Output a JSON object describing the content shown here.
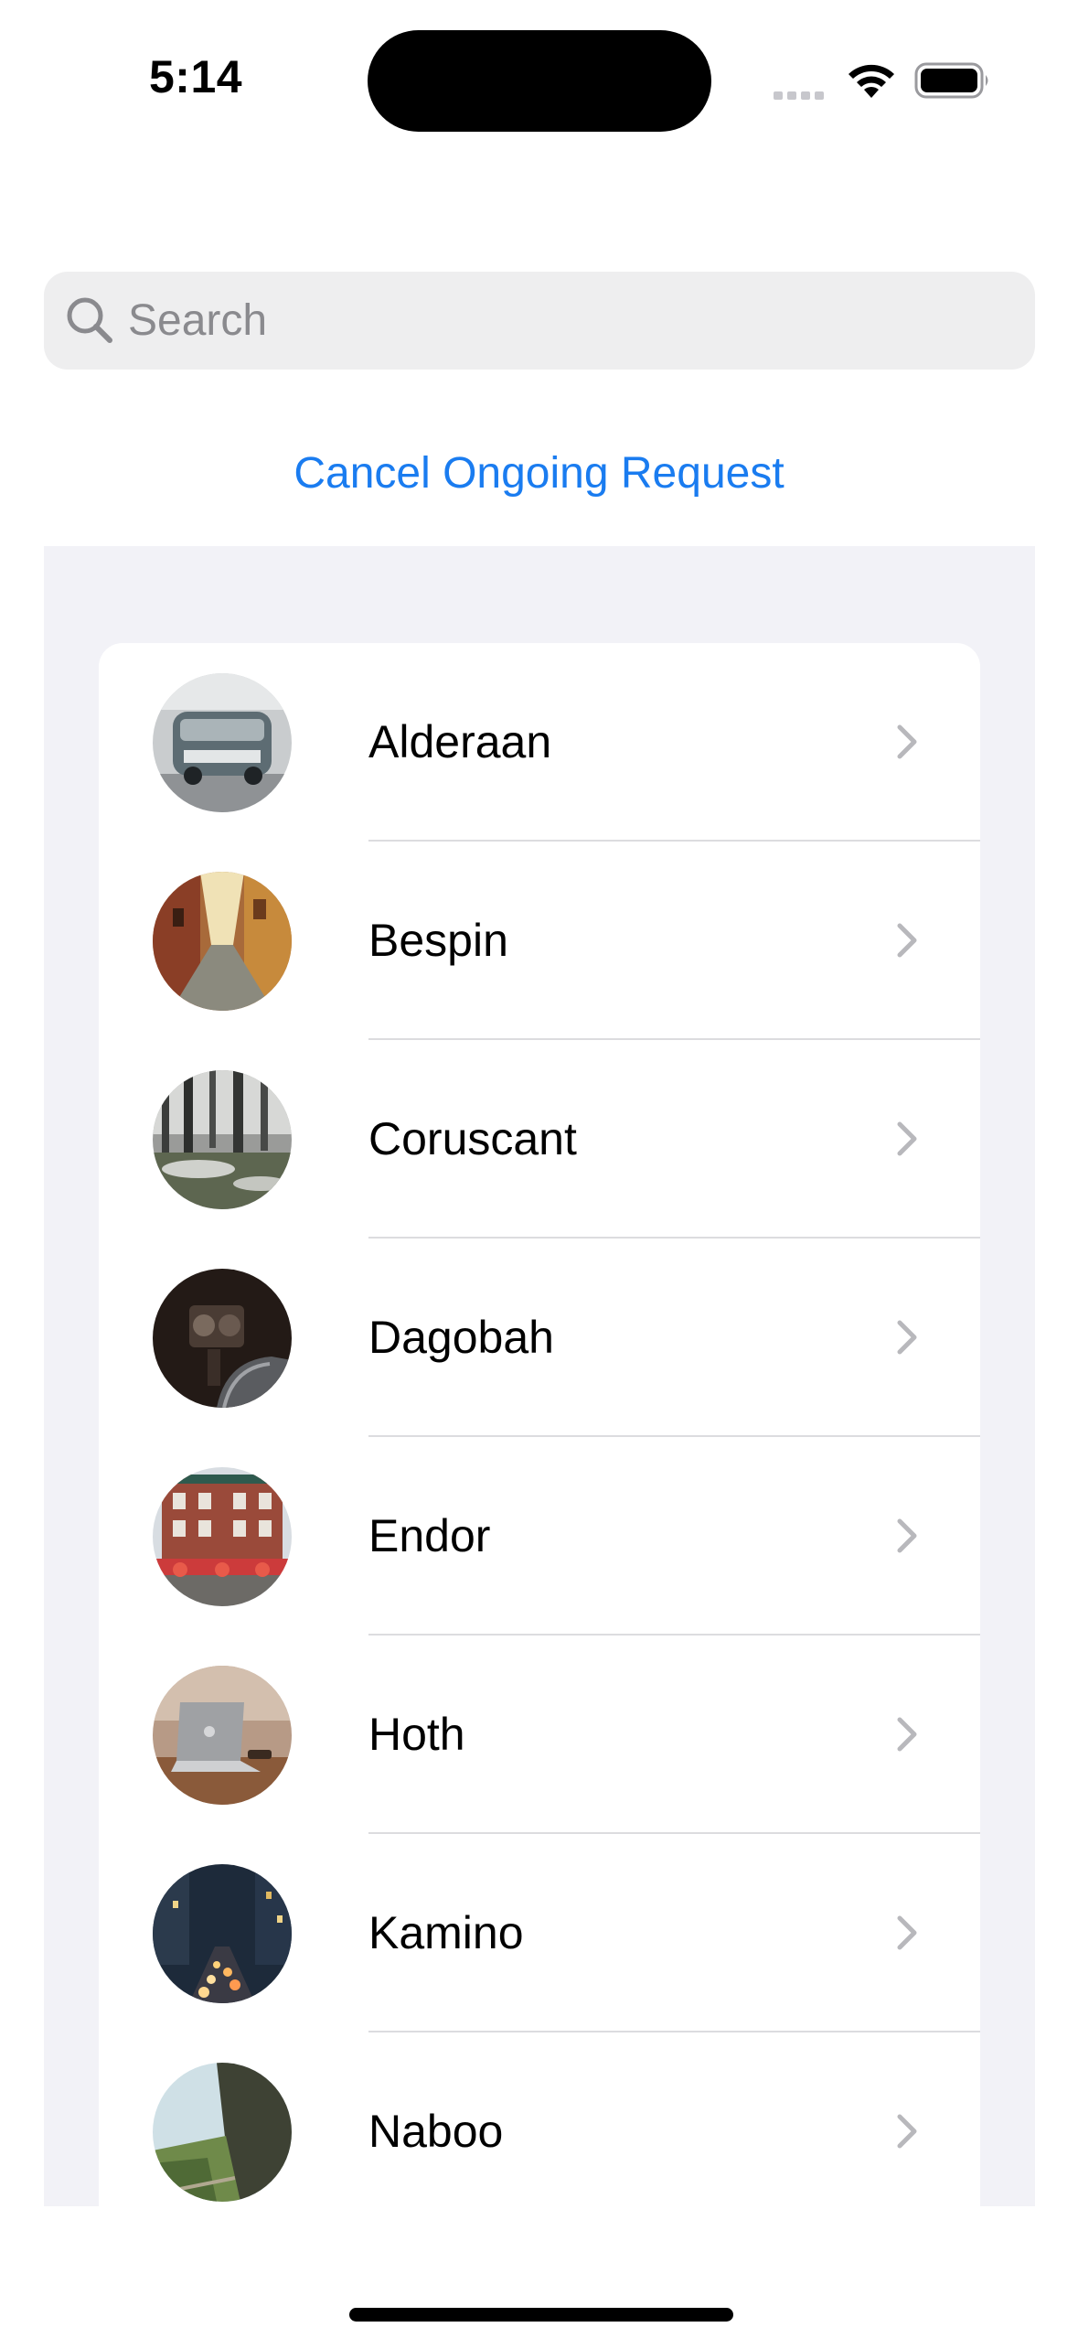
{
  "status_bar": {
    "time": "5:14"
  },
  "search": {
    "placeholder": "Search"
  },
  "cancel_label": "Cancel Ongoing Request",
  "colors": {
    "accent": "#1a7cf0",
    "list_background": "#f2f2f7",
    "chevron": "#b8b8bc"
  },
  "rows": [
    {
      "label": "Alderaan",
      "icon": "photo-vw-bus-avatar"
    },
    {
      "label": "Bespin",
      "icon": "photo-alley-avatar"
    },
    {
      "label": "Coruscant",
      "icon": "photo-forest-avatar"
    },
    {
      "label": "Dagobah",
      "icon": "photo-camera-avatar"
    },
    {
      "label": "Endor",
      "icon": "photo-building-avatar"
    },
    {
      "label": "Hoth",
      "icon": "photo-laptop-avatar"
    },
    {
      "label": "Kamino",
      "icon": "photo-city-night-avatar"
    },
    {
      "label": "Naboo",
      "icon": "photo-cliff-avatar"
    }
  ]
}
